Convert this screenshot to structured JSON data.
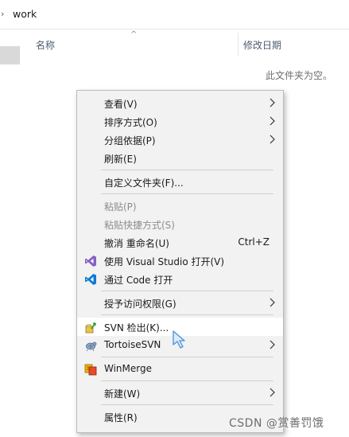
{
  "breadcrumb": {
    "arrow": "›",
    "folder": "work"
  },
  "header": {
    "sort_caret": "^",
    "name_col": "名称",
    "date_col": "修改日期"
  },
  "empty_message": "此文件夹为空。",
  "menu": {
    "view": "查看(V)",
    "sort_by": "排序方式(O)",
    "group_by": "分组依据(P)",
    "refresh": "刷新(E)",
    "customize": "自定义文件夹(F)...",
    "paste": "粘贴(P)",
    "paste_shortcut": "粘贴快捷方式(S)",
    "undo_rename": "撤消 重命名(U)",
    "undo_shortcut": "Ctrl+Z",
    "open_vs": "使用 Visual Studio 打开(V)",
    "open_code": "通过 Code 打开",
    "give_access": "授予访问权限(G)",
    "svn_checkout": "SVN 检出(K)...",
    "tortoise": "TortoiseSVN",
    "winmerge": "WinMerge",
    "new": "新建(W)",
    "properties": "属性(R)"
  },
  "watermark": "CSDN @赏善罚饿",
  "icons": {
    "vs": "visual-studio-icon",
    "code": "vscode-icon",
    "svn": "svn-checkout-icon",
    "tortoise": "tortoisesvn-icon",
    "winmerge": "winmerge-icon"
  },
  "colors": {
    "menu_bg": "#f2f2f2",
    "hover_bg": "#ffffff",
    "vs_purple": "#865fc5",
    "vscode_blue": "#0a7ad4"
  }
}
